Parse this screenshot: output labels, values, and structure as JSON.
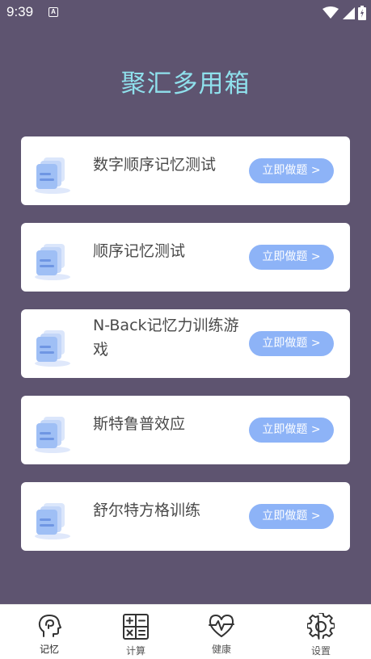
{
  "status_bar": {
    "time": "9:39",
    "notification_icon": "A"
  },
  "app": {
    "title": "聚汇多用箱"
  },
  "cards": [
    {
      "title": "数字顺序记忆测试",
      "button": "立即做题 >"
    },
    {
      "title": "顺序记忆测试",
      "button": "立即做题 >"
    },
    {
      "title": "N-Back记忆力训练游戏",
      "button": "立即做题 >"
    },
    {
      "title": "斯特鲁普效应",
      "button": "立即做题 >"
    },
    {
      "title": "舒尔特方格训练",
      "button": "立即做题 >"
    }
  ],
  "bottom_nav": [
    {
      "label": "记忆",
      "icon": "brain-head-icon",
      "active": true
    },
    {
      "label": "计算",
      "icon": "calculator-icon",
      "active": false
    },
    {
      "label": "健康",
      "icon": "heart-pulse-icon",
      "active": false
    },
    {
      "label": "设置",
      "icon": "gear-icon",
      "active": false
    }
  ],
  "colors": {
    "background": "#5e5470",
    "title": "#8fe0ec",
    "button": "#8db3f7",
    "card": "#ffffff"
  }
}
